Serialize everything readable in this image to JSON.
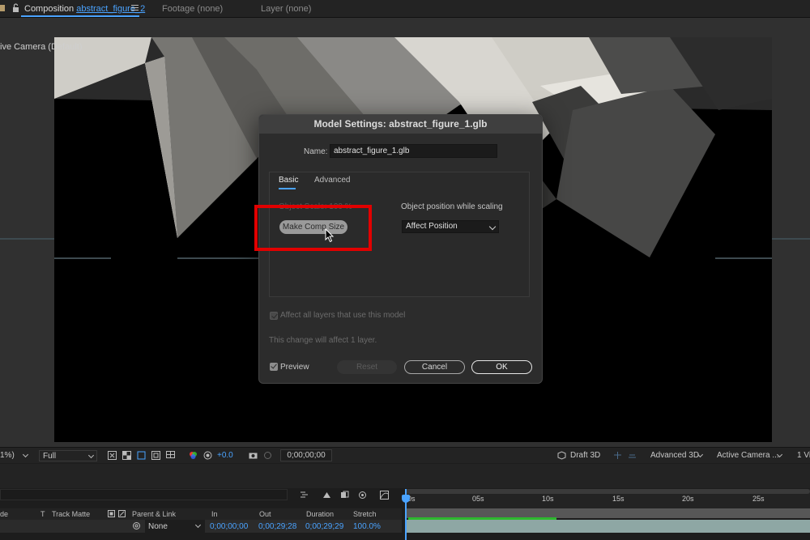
{
  "tabs": {
    "composition_prefix": "Composition",
    "composition_name": "abstract_figure_2",
    "footage": "Footage (none)",
    "layer": "Layer (none)"
  },
  "viewer": {
    "camera_label": "ive Camera (Default)"
  },
  "modal": {
    "title": "Model Settings: abstract_figure_1.glb",
    "name_label": "Name:",
    "name_value": "abstract_figure_1.glb",
    "tabs": [
      "Basic",
      "Advanced"
    ],
    "object_scale_label": "Object Scale: 100 %",
    "make_comp_size": "Make Comp Size",
    "object_position_label": "Object position while scaling",
    "affect_position": "Affect Position",
    "affect_all_layers": "Affect all layers that use this model",
    "change_note": "This change will affect 1 layer.",
    "preview": "Preview",
    "reset": "Reset",
    "cancel": "Cancel",
    "ok": "OK"
  },
  "toolbar": {
    "zoom": "1%)",
    "resolution": "Full",
    "exposure": "+0.0",
    "timecode": "0;00;00;00",
    "renderer_draft": "Draft 3D",
    "renderer": "Advanced 3D",
    "camera": "Active Camera ...",
    "views": "1 Vi"
  },
  "timeline": {
    "columns": {
      "mode": "de",
      "t": "T",
      "track_matte": "Track Matte",
      "parent_link": "Parent & Link",
      "in": "In",
      "out": "Out",
      "duration": "Duration",
      "stretch": "Stretch"
    },
    "row": {
      "parent": "None",
      "in": "0;00;00;00",
      "out": "0;00;29;28",
      "duration": "0;00;29;29",
      "stretch": "100.0%"
    },
    "ruler": [
      "0s",
      "05s",
      "10s",
      "15s",
      "20s",
      "25s"
    ]
  },
  "colors": {
    "accent": "#4aa3ff",
    "highlight": "#e10000",
    "panel": "#2c2c2c"
  }
}
